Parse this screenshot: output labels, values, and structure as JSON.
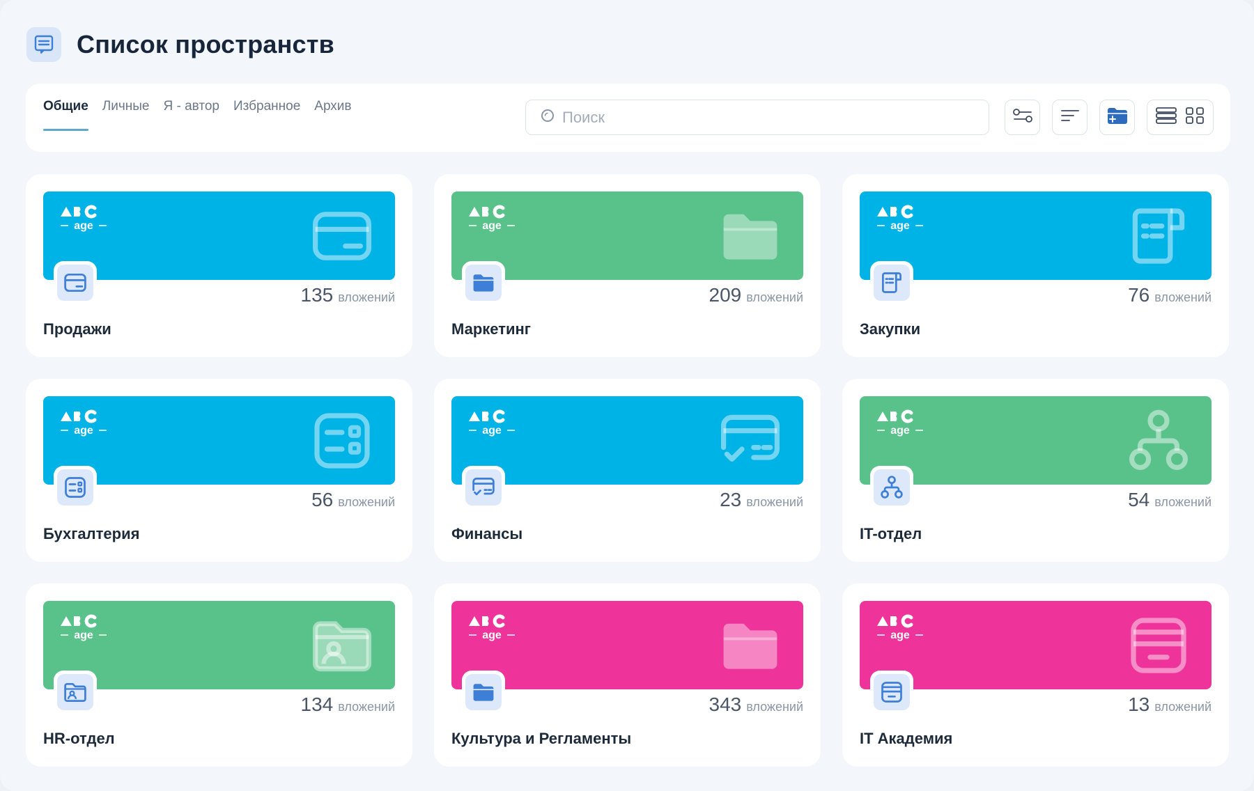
{
  "page": {
    "title": "Список пространств",
    "icon": "document-list-icon"
  },
  "tabs": [
    {
      "label": "Общие",
      "active": true
    },
    {
      "label": "Личные",
      "active": false
    },
    {
      "label": "Я - автор",
      "active": false
    },
    {
      "label": "Избранное",
      "active": false
    },
    {
      "label": "Архив",
      "active": false
    }
  ],
  "search": {
    "placeholder": "Поиск",
    "value": ""
  },
  "toolbar_icons": [
    "filter-icon",
    "sort-icon",
    "new-folder-icon",
    "list-view-icon",
    "grid-view-icon"
  ],
  "logo": {
    "top": "ABC",
    "bottom": "age"
  },
  "colors": {
    "blue": "#00b3e6",
    "green": "#59c18a",
    "pink": "#ee349b",
    "badge_icon": "#3d7ed6"
  },
  "spaces": [
    {
      "name": "Продажи",
      "count": "135",
      "count_label": "вложений",
      "color": "blue",
      "icon": "card-icon"
    },
    {
      "name": "Маркетинг",
      "count": "209",
      "count_label": "вложений",
      "color": "green",
      "icon": "folder-icon"
    },
    {
      "name": "Закупки",
      "count": "76",
      "count_label": "вложений",
      "color": "blue",
      "icon": "receipt-icon"
    },
    {
      "name": "Бухгалтерия",
      "count": "56",
      "count_label": "вложений",
      "color": "blue",
      "icon": "ledger-icon"
    },
    {
      "name": "Финансы",
      "count": "23",
      "count_label": "вложений",
      "color": "blue",
      "icon": "payment-check-icon"
    },
    {
      "name": "IT-отдел",
      "count": "54",
      "count_label": "вложений",
      "color": "green",
      "icon": "hierarchy-icon"
    },
    {
      "name": "HR-отдел",
      "count": "134",
      "count_label": "вложений",
      "color": "green",
      "icon": "user-folder-icon"
    },
    {
      "name": "Культура и Регламенты",
      "count": "343",
      "count_label": "вложений",
      "color": "pink",
      "icon": "folder-icon"
    },
    {
      "name": "IT Академия",
      "count": "13",
      "count_label": "вложений",
      "color": "pink",
      "icon": "archive-box-icon"
    }
  ]
}
